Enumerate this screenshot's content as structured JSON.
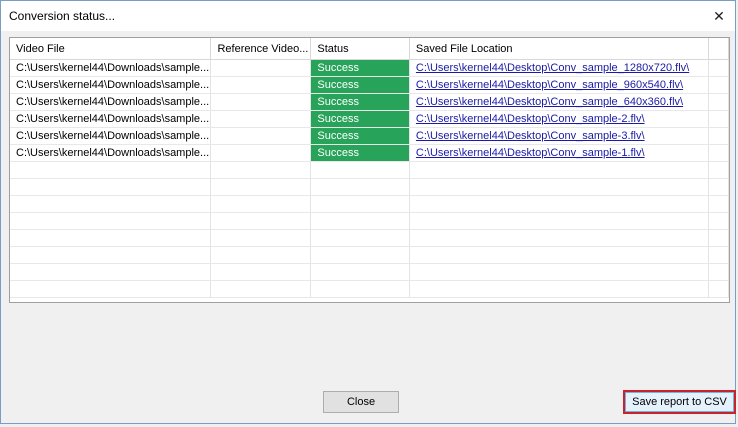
{
  "window": {
    "title": "Conversion status...",
    "close_glyph": "✕"
  },
  "grid": {
    "columns": [
      "Video File",
      "Reference Video...",
      "Status",
      "Saved File Location"
    ],
    "rows": [
      {
        "video": "C:\\Users\\kernel44\\Downloads\\sample...",
        "reference": "",
        "status": "Success",
        "location": "C:\\Users\\kernel44\\Desktop\\Conv_sample_1280x720.flv\\"
      },
      {
        "video": "C:\\Users\\kernel44\\Downloads\\sample...",
        "reference": "",
        "status": "Success",
        "location": "C:\\Users\\kernel44\\Desktop\\Conv_sample_960x540.flv\\"
      },
      {
        "video": "C:\\Users\\kernel44\\Downloads\\sample...",
        "reference": "",
        "status": "Success",
        "location": "C:\\Users\\kernel44\\Desktop\\Conv_sample_640x360.flv\\"
      },
      {
        "video": "C:\\Users\\kernel44\\Downloads\\sample...",
        "reference": "",
        "status": "Success",
        "location": "C:\\Users\\kernel44\\Desktop\\Conv_sample-2.flv\\"
      },
      {
        "video": "C:\\Users\\kernel44\\Downloads\\sample...",
        "reference": "",
        "status": "Success",
        "location": "C:\\Users\\kernel44\\Desktop\\Conv_sample-3.flv\\"
      },
      {
        "video": "C:\\Users\\kernel44\\Downloads\\sample...",
        "reference": "",
        "status": "Success",
        "location": "C:\\Users\\kernel44\\Desktop\\Conv_sample-1.flv\\"
      }
    ],
    "status_color": "#28a45a",
    "link_color": "#1a1aa6"
  },
  "buttons": {
    "close": "Close",
    "save_csv": "Save report to CSV"
  }
}
